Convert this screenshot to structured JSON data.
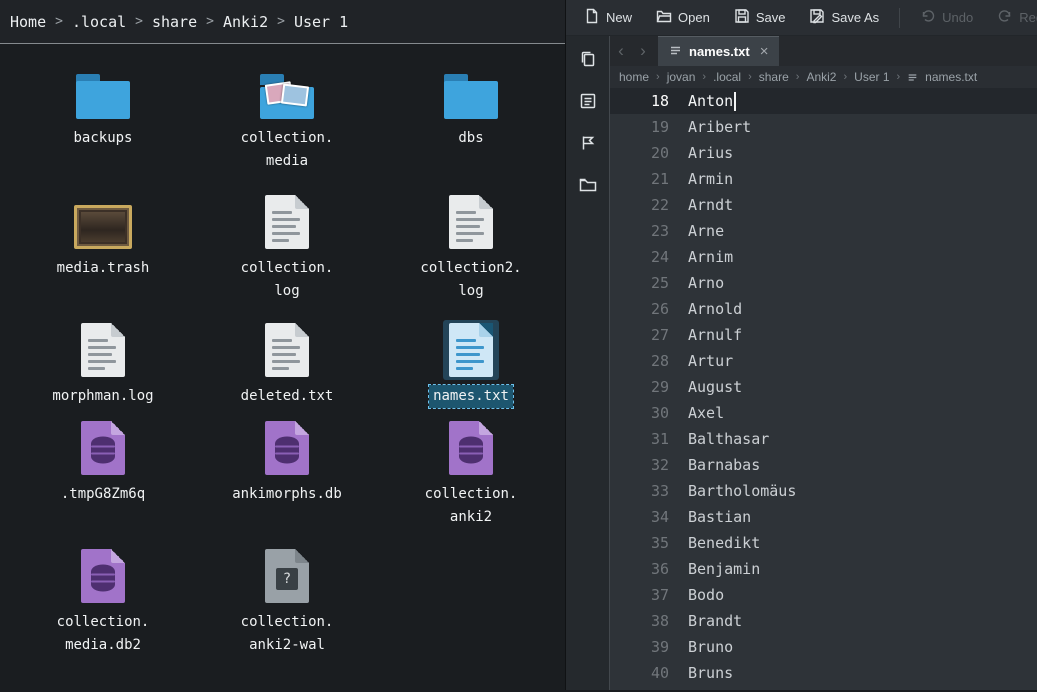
{
  "glyphs": {
    "question": "?"
  },
  "file_manager": {
    "separator": ">",
    "breadcrumb": [
      "Home",
      ".local",
      "share",
      "Anki2",
      "User 1"
    ],
    "files": [
      {
        "name": "backups",
        "display": "backups",
        "icon": "folder",
        "selected": false
      },
      {
        "name": "collection.media",
        "display": "collection.\nmedia",
        "icon": "folder-media",
        "selected": false
      },
      {
        "name": "dbs",
        "display": "dbs",
        "icon": "folder",
        "selected": false
      },
      {
        "name": "media.trash",
        "display": "media.trash",
        "icon": "image",
        "selected": false
      },
      {
        "name": "collection.log",
        "display": "collection.\nlog",
        "icon": "text",
        "selected": false
      },
      {
        "name": "collection2.log",
        "display": "collection2.\nlog",
        "icon": "text",
        "selected": false
      },
      {
        "name": "morphman.log",
        "display": "morphman.log",
        "icon": "text",
        "selected": false
      },
      {
        "name": "deleted.txt",
        "display": "deleted.txt",
        "icon": "text",
        "selected": false
      },
      {
        "name": "names.txt",
        "display": "names.txt",
        "icon": "text",
        "selected": true
      },
      {
        "name": ".tmpG8Zm6q",
        "display": ".tmpG8Zm6q",
        "icon": "database",
        "selected": false
      },
      {
        "name": "ankimorphs.db",
        "display": "ankimorphs.db",
        "icon": "database",
        "selected": false
      },
      {
        "name": "collection.anki2",
        "display": "collection.\nanki2",
        "icon": "database",
        "selected": false
      },
      {
        "name": "collection.media.db2",
        "display": "collection.\nmedia.db2",
        "icon": "database",
        "selected": false
      },
      {
        "name": "collection.anki2-wal",
        "display": "collection.\nanki2-wal",
        "icon": "unknown",
        "selected": false
      }
    ]
  },
  "editor": {
    "separator": "›",
    "toolbar": {
      "new": "New",
      "open": "Open",
      "save": "Save",
      "save_as": "Save As",
      "undo": "Undo",
      "redo": "Redo"
    },
    "tab_nav": {
      "back": "‹",
      "forward": "›"
    },
    "tab": {
      "title": "names.txt",
      "close": "×"
    },
    "breadcrumb": [
      "home",
      "jovan",
      ".local",
      "share",
      "Anki2",
      "User 1",
      "names.txt"
    ],
    "lines": [
      {
        "n": 18,
        "t": "Anton",
        "current": true
      },
      {
        "n": 19,
        "t": "Aribert"
      },
      {
        "n": 20,
        "t": "Arius"
      },
      {
        "n": 21,
        "t": "Armin"
      },
      {
        "n": 22,
        "t": "Arndt"
      },
      {
        "n": 23,
        "t": "Arne"
      },
      {
        "n": 24,
        "t": "Arnim"
      },
      {
        "n": 25,
        "t": "Arno"
      },
      {
        "n": 26,
        "t": "Arnold"
      },
      {
        "n": 27,
        "t": "Arnulf"
      },
      {
        "n": 28,
        "t": "Artur"
      },
      {
        "n": 29,
        "t": "August"
      },
      {
        "n": 30,
        "t": "Axel"
      },
      {
        "n": 31,
        "t": "Balthasar"
      },
      {
        "n": 32,
        "t": "Barnabas"
      },
      {
        "n": 33,
        "t": "Bartholomäus"
      },
      {
        "n": 34,
        "t": "Bastian"
      },
      {
        "n": 35,
        "t": "Benedikt"
      },
      {
        "n": 36,
        "t": "Benjamin"
      },
      {
        "n": 37,
        "t": "Bodo"
      },
      {
        "n": 38,
        "t": "Brandt"
      },
      {
        "n": 39,
        "t": "Bruno"
      },
      {
        "n": 40,
        "t": "Bruns"
      }
    ]
  }
}
